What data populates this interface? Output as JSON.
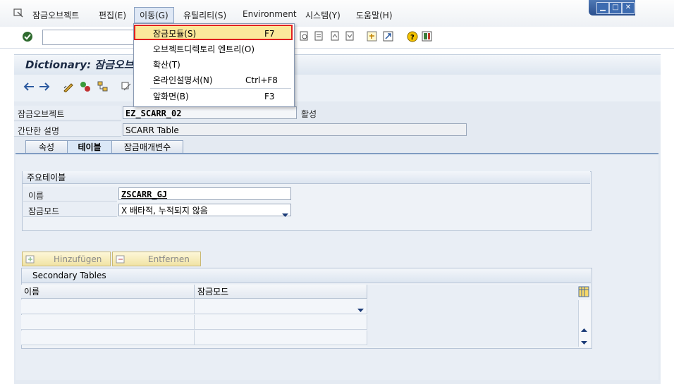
{
  "menubar": {
    "items": [
      {
        "label": "잠금오브젝트"
      },
      {
        "label": "편집(E)"
      },
      {
        "label": "이동(G)"
      },
      {
        "label": "유틸리티(S)"
      },
      {
        "label": "Environment"
      },
      {
        "label": "시스템(Y)"
      },
      {
        "label": "도움말(H)"
      }
    ]
  },
  "dropdown": {
    "items": [
      {
        "label": "잠금모듈(S)",
        "shortcut": "F7"
      },
      {
        "label": "오브젝트디렉토리 엔트리(O)",
        "shortcut": ""
      },
      {
        "label": "확산(T)",
        "shortcut": ""
      },
      {
        "label": "온라인설명서(N)",
        "shortcut": "Ctrl+F8"
      },
      {
        "label": "앞화면(B)",
        "shortcut": "F3"
      }
    ]
  },
  "page": {
    "title": "Dictionary: 잠금오브"
  },
  "form": {
    "lock_object_label": "잠금오브젝트",
    "lock_object_value": "EZ_SCARR_02",
    "status": "활성",
    "short_desc_label": "간단한 설명",
    "short_desc_value": "SCARR Table"
  },
  "tabs": [
    {
      "label": "속성"
    },
    {
      "label": "테이블"
    },
    {
      "label": "잠금매개변수"
    }
  ],
  "primary_table": {
    "group_title": "주요테이블",
    "name_label": "이름",
    "name_value": "ZSCARR_GJ",
    "lock_mode_label": "잠금모드",
    "lock_mode_value": "X 배타적, 누적되지 않음"
  },
  "buttons": {
    "add": "Hinzufügen",
    "remove": "Entfernen"
  },
  "secondary_tables": {
    "title": "Secondary Tables",
    "columns": [
      "이름",
      "잠금모드"
    ]
  },
  "colors": {
    "highlight": "#fbe89a",
    "highlight_border": "#e02020",
    "title_bar": "#2b4f8e"
  }
}
